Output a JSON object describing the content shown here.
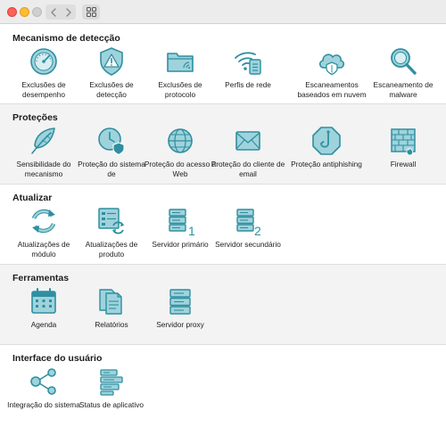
{
  "window": {
    "controls": [
      "close",
      "minimize",
      "zoom"
    ]
  },
  "toolbar": {
    "back_icon": "chevron-left",
    "forward_icon": "chevron-right",
    "view_icon": "grid-view"
  },
  "accent_color": "#2f8fa0",
  "accent_fill": "#9fd3dc",
  "sections": [
    {
      "title": "Mecanismo de detecção",
      "items": [
        {
          "label": "Exclusões de desempenho",
          "icon": "gauge-icon"
        },
        {
          "label": "Exclusões de detecção",
          "icon": "shield-warning-icon"
        },
        {
          "label": "Exclusões de protocolo",
          "icon": "folder-icon"
        },
        {
          "label": "Perfis de rede",
          "icon": "wifi-profile-icon"
        },
        {
          "label": "Escaneamentos baseados em nuvem",
          "icon": "cloud-shield-icon"
        },
        {
          "label": "Escaneamento de malware",
          "icon": "magnifier-icon"
        }
      ]
    },
    {
      "title": "Proteções",
      "items": [
        {
          "label": "Sensibilidade do mecanismo",
          "icon": "feather-icon"
        },
        {
          "label": "Proteção do sistema de",
          "icon": "clock-shield-icon"
        },
        {
          "label": "Proteção do acesso à Web",
          "icon": "globe-icon"
        },
        {
          "label": "Proteção do cliente de email",
          "icon": "envelope-icon"
        },
        {
          "label": "Proteção antiphishing",
          "icon": "hook-icon"
        },
        {
          "label": "Firewall",
          "icon": "firewall-icon"
        }
      ]
    },
    {
      "title": "Atualizar",
      "items": [
        {
          "label": "Atualizações de módulo",
          "icon": "refresh-icon"
        },
        {
          "label": "Atualizações de produto",
          "icon": "product-update-icon"
        },
        {
          "label": "Servidor primário",
          "icon": "server-primary-icon",
          "badge": "1"
        },
        {
          "label": "Servidor secundário",
          "icon": "server-secondary-icon",
          "badge": "2"
        }
      ]
    },
    {
      "title": "Ferramentas",
      "items": [
        {
          "label": "Agenda",
          "icon": "calendar-icon"
        },
        {
          "label": "Relatórios",
          "icon": "reports-icon"
        },
        {
          "label": "Servidor proxy",
          "icon": "server-icon"
        }
      ]
    },
    {
      "title": "Interface do usuário",
      "items": [
        {
          "label": "Integração do sistema",
          "icon": "share-nodes-icon"
        },
        {
          "label": "Status de aplicativo",
          "icon": "status-list-icon"
        }
      ]
    }
  ]
}
